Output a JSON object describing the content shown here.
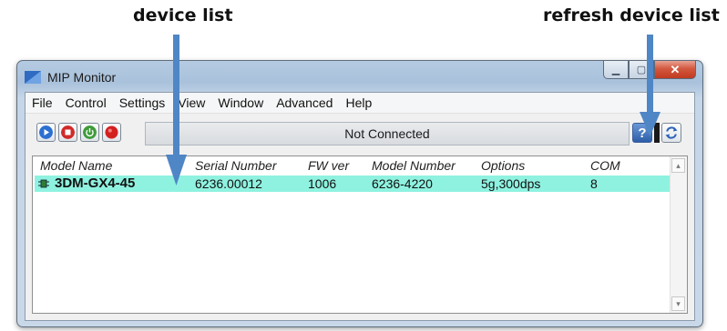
{
  "annotations": {
    "device_list": "device list",
    "refresh_device_list": "refresh device list"
  },
  "window": {
    "title": "MIP Monitor",
    "min_glyph": "▁",
    "max_glyph": "▢",
    "close_glyph": "✕"
  },
  "menu": [
    "File",
    "Control",
    "Settings",
    "View",
    "Window",
    "Advanced",
    "Help"
  ],
  "toolbar": {
    "status": "Not Connected",
    "help_glyph": "?",
    "buttons": [
      "play-icon",
      "stop-icon",
      "power-icon",
      "record-icon"
    ]
  },
  "device_list": {
    "columns": [
      "Model Name",
      "Serial Number",
      "FW ver",
      "Model Number",
      "Options",
      "COM"
    ],
    "rows": [
      {
        "model_name": "3DM-GX4-45",
        "serial_number": "6236.00012",
        "fw_ver": "1006",
        "model_number": "6236-4220",
        "options": "5g,300dps",
        "com": "8"
      }
    ]
  },
  "colors": {
    "selected_row": "#8ff2e0",
    "arrow": "#4f86c6",
    "status_text": "#1a1a1a"
  }
}
